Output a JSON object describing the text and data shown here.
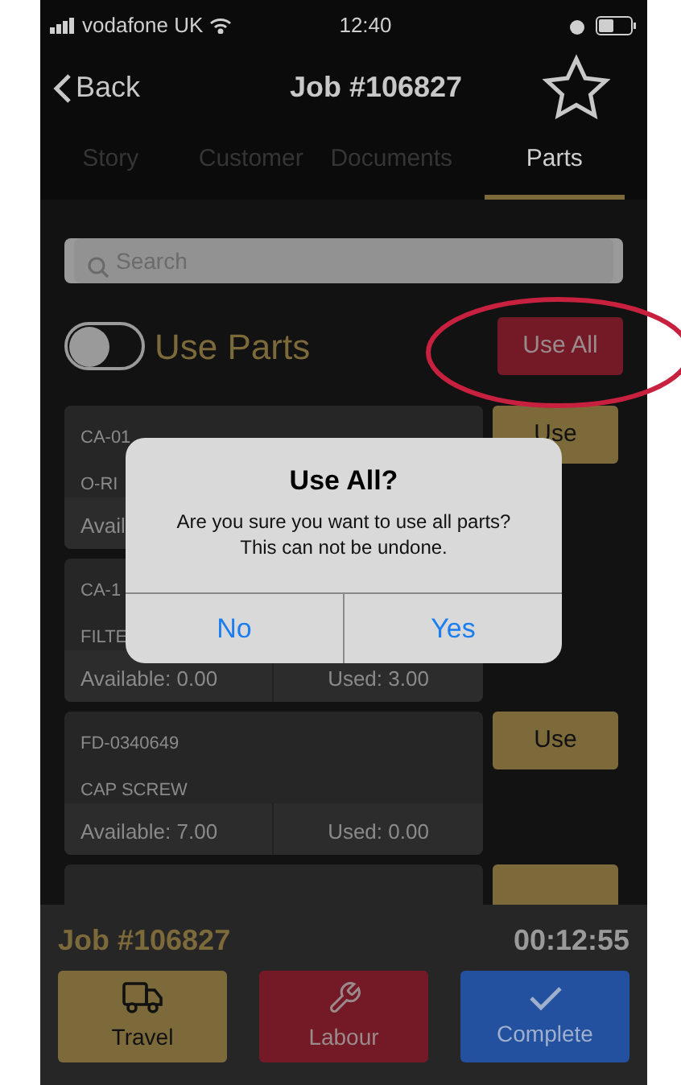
{
  "status_bar": {
    "carrier": "vodafone UK",
    "time": "12:40"
  },
  "nav": {
    "back": "Back",
    "title": "Job #106827",
    "favorite": false
  },
  "tabs": [
    {
      "label": "Story",
      "selected": false
    },
    {
      "label": "Customer",
      "selected": false
    },
    {
      "label": "Documents",
      "selected": false
    },
    {
      "label": "Parts",
      "selected": true
    }
  ],
  "search": {
    "placeholder": "Search"
  },
  "use_parts": {
    "label": "Use Parts",
    "on": false,
    "use_all": "Use All"
  },
  "parts": [
    {
      "code": "CA-01",
      "name": "O-RI",
      "available": "Avail",
      "action": "Use"
    },
    {
      "code": "CA-1",
      "name": "FILTE",
      "available": "Available: 0.00",
      "used": "Used: 3.00"
    },
    {
      "code": "FD-0340649",
      "name": "CAP SCREW",
      "available": "Available: 7.00",
      "used": "Used: 0.00",
      "action": "Use"
    }
  ],
  "footer": {
    "job": "Job #106827",
    "timer": "00:12:55",
    "buttons": [
      {
        "kind": "travel",
        "label": "Travel"
      },
      {
        "kind": "labour",
        "label": "Labour"
      },
      {
        "kind": "complete",
        "label": "Complete"
      }
    ]
  },
  "dialog": {
    "title": "Use All?",
    "message": [
      "Are you sure you want to use all parts?",
      "This can not be undone."
    ],
    "buttons": [
      "No",
      "Yes"
    ]
  }
}
